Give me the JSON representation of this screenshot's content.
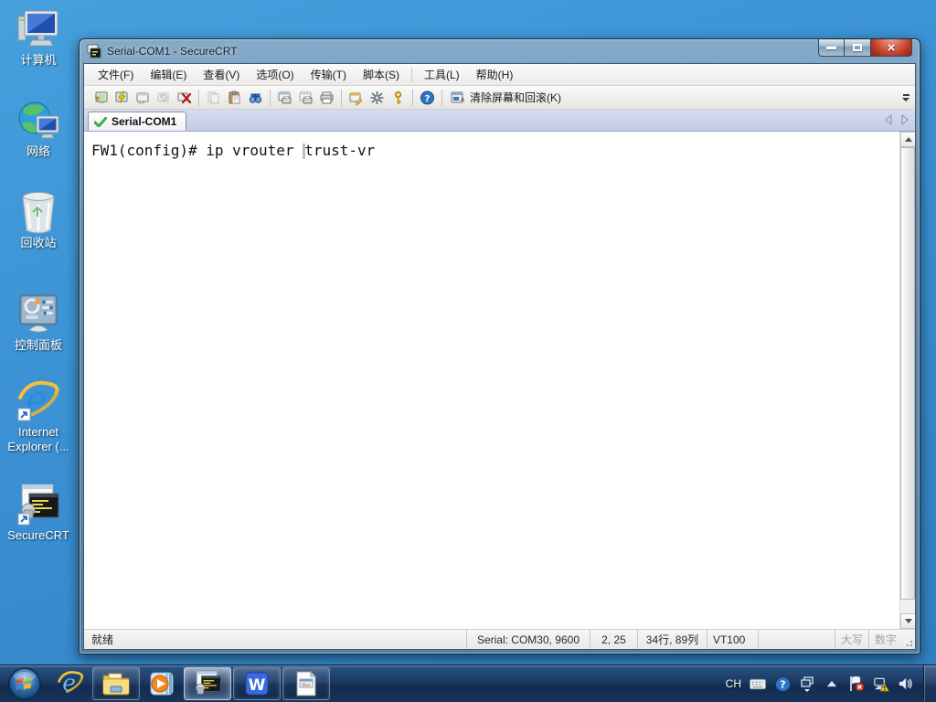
{
  "desktop": {
    "accent_background": "#3a90d3",
    "icons": [
      {
        "label": "计算机",
        "icon": "computer-icon"
      },
      {
        "label": "网络",
        "icon": "network-icon"
      },
      {
        "label": "回收站",
        "icon": "recycle-bin-icon"
      },
      {
        "label": "控制面板",
        "icon": "control-panel-icon"
      },
      {
        "label": "Internet Explorer (...",
        "icon": "internet-explorer-icon"
      },
      {
        "label": "SecureCRT",
        "icon": "securecrt-icon"
      }
    ]
  },
  "window": {
    "title": "Serial-COM1 - SecureCRT",
    "controls": {
      "close_glyph": "×"
    },
    "menu": {
      "items": [
        "文件(F)",
        "编辑(E)",
        "查看(V)",
        "选项(O)",
        "传输(T)",
        "脚本(S)",
        "工具(L)",
        "帮助(H)"
      ]
    },
    "toolbar": {
      "icons": [
        {
          "name": "connect-icon",
          "enabled": true
        },
        {
          "name": "quick-connect-icon",
          "enabled": true
        },
        {
          "name": "new-session-icon",
          "enabled": true
        },
        {
          "name": "reconnect-icon",
          "enabled": false
        },
        {
          "name": "disconnect-icon",
          "enabled": true
        },
        {
          "name": "copy-icon",
          "enabled": false
        },
        {
          "name": "paste-icon",
          "enabled": true
        },
        {
          "name": "find-icon",
          "enabled": true
        },
        {
          "name": "print-screen-icon",
          "enabled": true
        },
        {
          "name": "print-selection-icon",
          "enabled": true
        },
        {
          "name": "print-icon",
          "enabled": true
        },
        {
          "name": "session-options-icon",
          "enabled": true
        },
        {
          "name": "keymap-icon",
          "enabled": true
        },
        {
          "name": "key-agent-icon",
          "enabled": true
        },
        {
          "name": "help-icon",
          "enabled": true
        }
      ],
      "clear_button": {
        "label": "清除屏幕和回滚(K)",
        "icon": "clear-screen-icon"
      }
    },
    "tabs": [
      {
        "label": "Serial-COM1",
        "icon": "connected-check-icon",
        "active": true
      }
    ],
    "terminal": {
      "text_before_cursor": "FW1(config)# ip vrouter ",
      "text_after_cursor": "trust-vr"
    },
    "status_bar": {
      "ready_label": "就绪",
      "serial_info": "Serial: COM30, 9600",
      "cursor_position": "2, 25",
      "screen_size": "34行, 89列",
      "emulation": "VT100",
      "caps_label": "大写",
      "num_label": "数字"
    }
  },
  "taskbar": {
    "buttons": [
      {
        "name": "start",
        "icon": "windows-start-icon"
      },
      {
        "name": "internet-explorer",
        "icon": "internet-explorer-icon",
        "state": "pinned"
      },
      {
        "name": "windows-explorer",
        "icon": "folder-icon",
        "state": "running"
      },
      {
        "name": "windows-media-player",
        "icon": "media-player-icon",
        "state": "pinned"
      },
      {
        "name": "securecrt",
        "icon": "securecrt-icon",
        "state": "active"
      },
      {
        "name": "wps-writer",
        "icon": "wps-w-icon",
        "state": "running"
      },
      {
        "name": "generic-document-app",
        "icon": "document-app-icon",
        "state": "running"
      }
    ],
    "tray": {
      "language_indicator": "CH",
      "icons": [
        "keyboard-icon",
        "help-icon",
        "toolbar-window-icon",
        "show-hidden-icons-icon",
        "action-center-flag-icon",
        "network-warning-icon",
        "speaker-icon"
      ]
    }
  }
}
